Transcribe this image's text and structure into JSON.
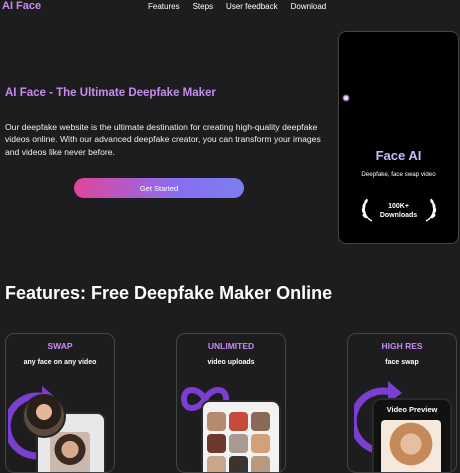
{
  "nav": {
    "logo": "AI Face",
    "links": [
      "Features",
      "Steps",
      "User feedback",
      "Download"
    ]
  },
  "hero": {
    "title": "AI Face - The Ultimate Deepfake Maker",
    "description": "Our deepfake website is the ultimate destination for creating high-quality deepfake videos online. With our advanced deepfake creator, you can transform your images and videos like never before.",
    "cta_label": "Get Started"
  },
  "phone": {
    "brand": "Face AI",
    "tagline": "Deepfake, face swap video",
    "badge_count": "100K+",
    "badge_label": "Downloads"
  },
  "features": {
    "title": "Features: Free Deepfake Maker Online",
    "cards": [
      {
        "title": "SWAP",
        "subtitle": "any face on any video"
      },
      {
        "title": "UNLIMITED",
        "subtitle": "video uploads"
      },
      {
        "title": "HIGH RES",
        "subtitle": "face swap",
        "preview_label": "Video Preview"
      }
    ]
  },
  "colors": {
    "background": "#1d1d1f",
    "accent": "#c58cf0",
    "cta_gradient_start": "#e0459c",
    "cta_gradient_end": "#7b7ff0"
  }
}
